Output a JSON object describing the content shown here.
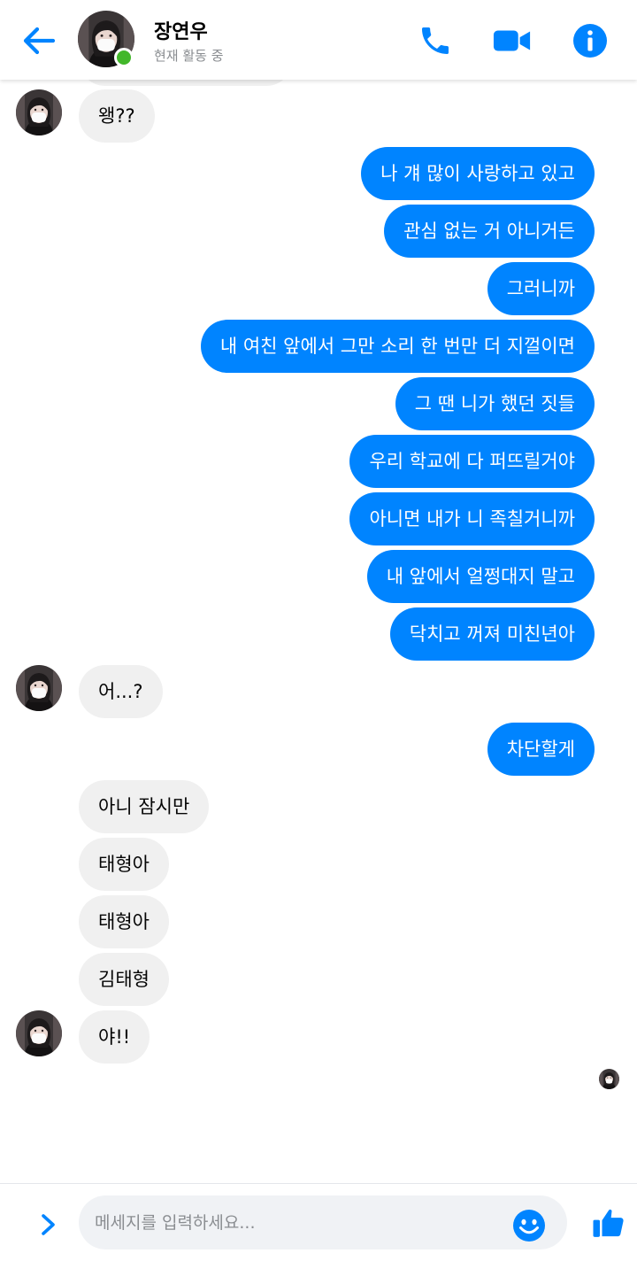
{
  "header": {
    "contact_name": "장연우",
    "status": "현재 활동 중",
    "back_icon": "back-arrow-icon",
    "call_icon": "phone-icon",
    "video_icon": "video-camera-icon",
    "info_icon": "info-icon"
  },
  "messages": [
    {
      "dir": "in",
      "text": "왱??"
    },
    {
      "dir": "out",
      "text": "나 걔 많이 사랑하고 있고"
    },
    {
      "dir": "out",
      "text": "관심 없는 거 아니거든"
    },
    {
      "dir": "out",
      "text": "그러니까"
    },
    {
      "dir": "out",
      "text": "내 여친 앞에서 그만 소리 한 번만 더 지껄이면"
    },
    {
      "dir": "out",
      "text": "그 땐 니가 했던 짓들"
    },
    {
      "dir": "out",
      "text": "우리 학교에 다 퍼뜨릴거야"
    },
    {
      "dir": "out",
      "text": "아니면 내가 니 족칠거니까"
    },
    {
      "dir": "out",
      "text": "내 앞에서 얼쩡대지 말고"
    },
    {
      "dir": "out",
      "text": "닥치고 꺼져 미친년아"
    },
    {
      "dir": "in",
      "text": "어...?"
    },
    {
      "dir": "out",
      "text": "차단할게"
    },
    {
      "dir": "in",
      "text": "아니 잠시만"
    },
    {
      "dir": "in",
      "text": "태형아"
    },
    {
      "dir": "in",
      "text": "태형아"
    },
    {
      "dir": "in",
      "text": "김태형"
    },
    {
      "dir": "in",
      "text": "야!!"
    }
  ],
  "composer": {
    "placeholder": "메세지를 입력하세요...",
    "value": "",
    "expand_icon": "chevron-right-icon",
    "emoji_icon": "smiley-icon",
    "like_icon": "thumbs-up-icon"
  },
  "colors": {
    "accent": "#0084ff",
    "incoming_bubble": "#f0f0f0",
    "online": "#42b72a"
  }
}
